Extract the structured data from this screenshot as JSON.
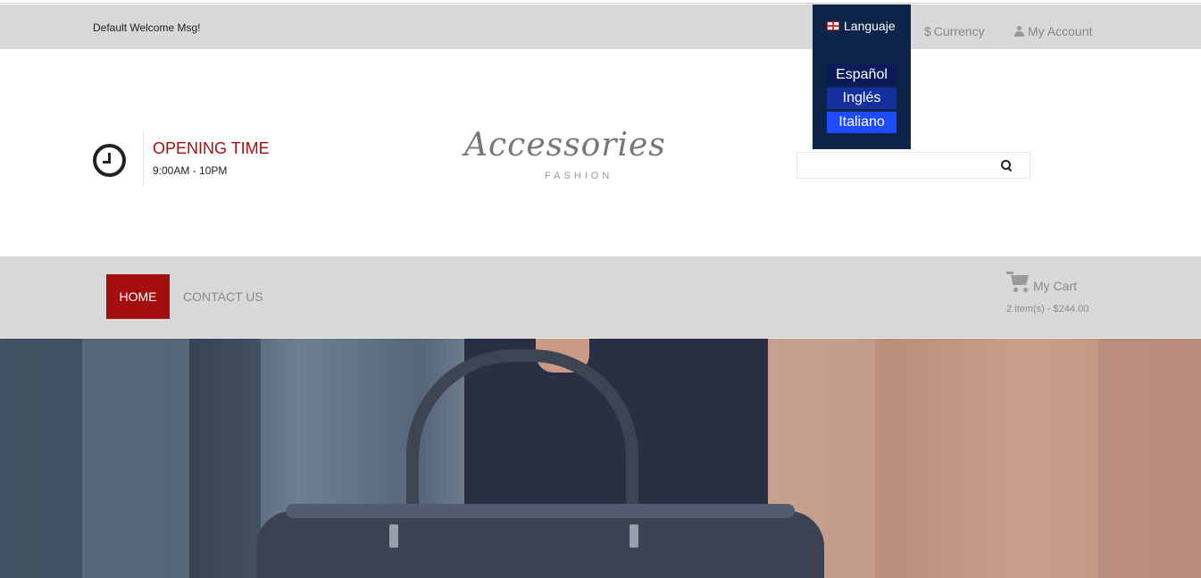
{
  "topbar": {
    "welcome": "Default Welcome Msg!",
    "language": {
      "label": "Languaje",
      "options": [
        "Español",
        "Inglés",
        "Italiano"
      ]
    },
    "currency": {
      "symbol": "$",
      "label": "Currency"
    },
    "account": "My Account"
  },
  "header": {
    "opening_title": "OPENING TIME",
    "opening_hours": "9:00AM - 10PM",
    "logo_script": "Accessories",
    "logo_sub": "FASHION",
    "search_placeholder": ""
  },
  "nav": {
    "home": "HOME",
    "contact": "CONTACT US"
  },
  "cart": {
    "label": "My Cart",
    "summary": "2 item(s) - $244.00"
  },
  "colors": {
    "accent": "#a40e0e",
    "topbar_bg": "#d8d8d8",
    "lang_dropdown_bg": "#0d2347"
  }
}
